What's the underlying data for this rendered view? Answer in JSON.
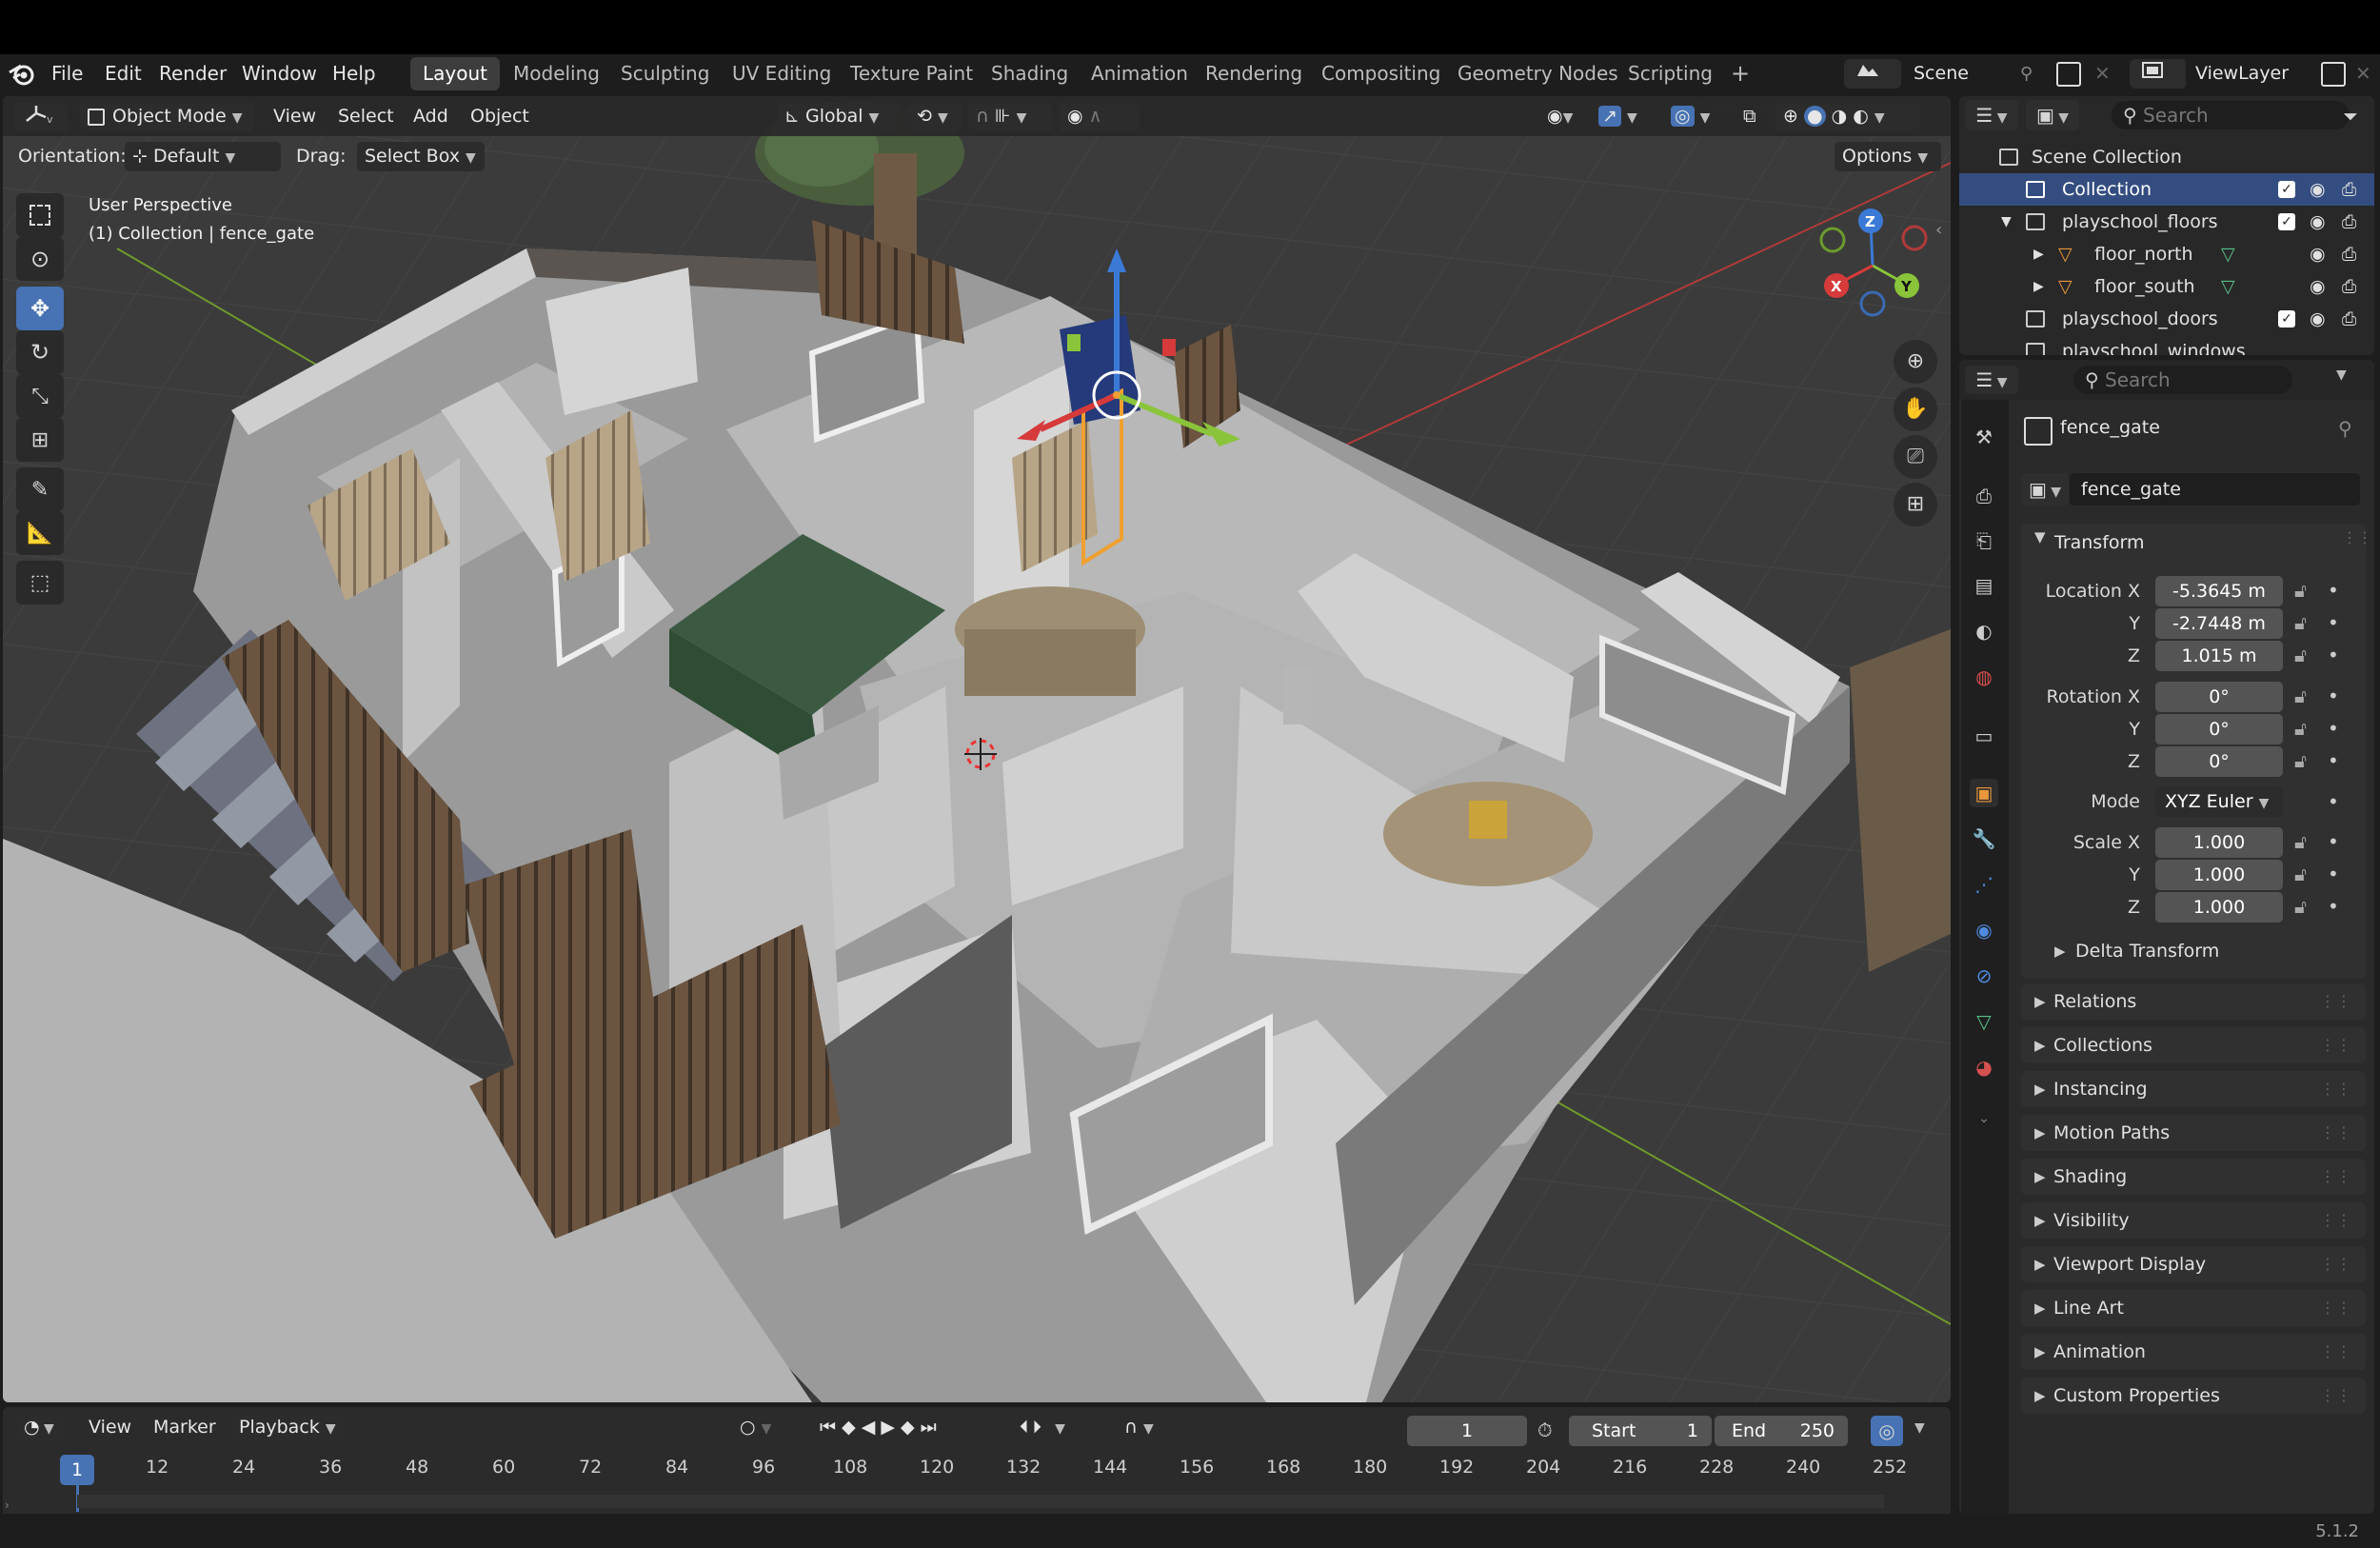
{
  "app": {
    "version": "5.1.2"
  },
  "menu": [
    "File",
    "Edit",
    "Render",
    "Window",
    "Help"
  ],
  "workspaces": [
    "Layout",
    "Modeling",
    "Sculpting",
    "UV Editing",
    "Texture Paint",
    "Shading",
    "Animation",
    "Rendering",
    "Compositing",
    "Geometry Nodes",
    "Scripting"
  ],
  "active_workspace": "Layout",
  "scene": {
    "label": "Scene",
    "view_layer": "ViewLayer"
  },
  "viewport_header": {
    "mode": "Object Mode",
    "menus": [
      "View",
      "Select",
      "Add",
      "Object"
    ],
    "transform_orientation": "Global",
    "options": "Options"
  },
  "tool_settings": {
    "orientation_label": "Orientation:",
    "orientation_value": "Default",
    "drag_label": "Drag:",
    "drag_value": "Select Box"
  },
  "viewport_overlay": {
    "perspective": "User Perspective",
    "collection_line": "(1) Collection | fence_gate"
  },
  "gizmo_axes": [
    "X",
    "Y",
    "Z"
  ],
  "outliner": {
    "search_placeholder": "Search",
    "items": [
      {
        "label": "Scene Collection",
        "depth": 0,
        "type": "scene"
      },
      {
        "label": "Collection",
        "depth": 1,
        "type": "collection",
        "highlighted": true
      },
      {
        "label": "playschool_floors",
        "depth": 1,
        "type": "collection",
        "expanded": true
      },
      {
        "label": "floor_north",
        "depth": 2,
        "type": "mesh"
      },
      {
        "label": "floor_south",
        "depth": 2,
        "type": "mesh"
      },
      {
        "label": "playschool_doors",
        "depth": 1,
        "type": "collection"
      },
      {
        "label": "playschool_windows",
        "depth": 1,
        "type": "collection"
      }
    ]
  },
  "properties": {
    "search_placeholder": "Search",
    "object_name": "fence_gate",
    "datablock_name": "fence_gate",
    "transform": {
      "title": "Transform",
      "location_label": "Location X",
      "location": [
        "-5.3645 m",
        "-2.7448 m",
        "1.015 m"
      ],
      "rotation_label": "Rotation X",
      "rotation": [
        "0°",
        "0°",
        "0°"
      ],
      "mode_label": "Mode",
      "mode": "XYZ Euler",
      "scale_label": "Scale X",
      "scale": [
        "1.000",
        "1.000",
        "1.000"
      ],
      "axis_y": "Y",
      "axis_z": "Z",
      "delta": "Delta Transform"
    },
    "panels": [
      "Relations",
      "Collections",
      "Instancing",
      "Motion Paths",
      "Shading",
      "Visibility",
      "Viewport Display",
      "Line Art",
      "Animation",
      "Custom Properties"
    ]
  },
  "timeline": {
    "menus": [
      "View",
      "Marker",
      "Playback"
    ],
    "current_frame": "1",
    "start_label": "Start",
    "start": "1",
    "end_label": "End",
    "end": "250",
    "ticks": [
      "1",
      "12",
      "24",
      "36",
      "48",
      "60",
      "72",
      "84",
      "96",
      "108",
      "120",
      "132",
      "144",
      "156",
      "168",
      "180",
      "192",
      "204",
      "216",
      "228",
      "240",
      "252"
    ]
  },
  "colors": {
    "accent": "#4772b3",
    "selected_outline": "#f0a030",
    "x_axis": "#d63a3a",
    "y_axis": "#8ac43a",
    "z_axis": "#3a7ad6"
  }
}
